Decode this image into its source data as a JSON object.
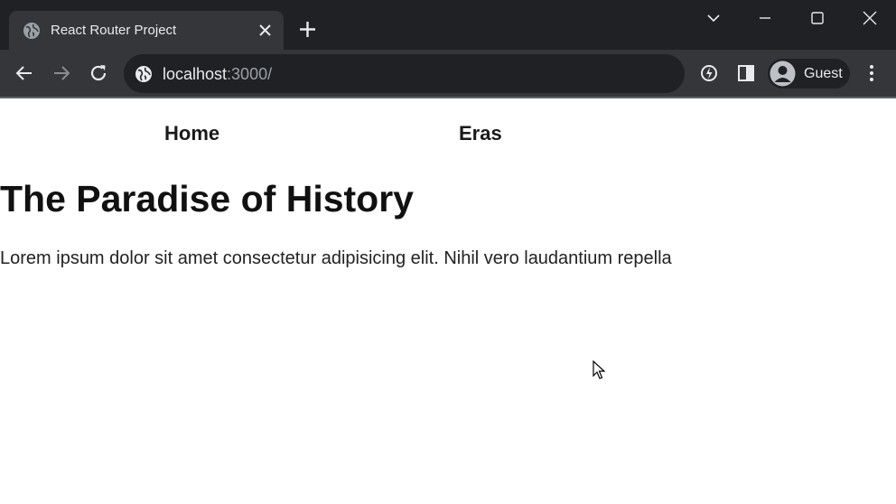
{
  "browser": {
    "tab": {
      "title": "React Router Project"
    },
    "address": {
      "host": "localhost",
      "rest": ":3000/"
    },
    "profile": {
      "label": "Guest"
    }
  },
  "page": {
    "nav": [
      {
        "label": "Home"
      },
      {
        "label": "Eras"
      }
    ],
    "title": "The Paradise of History",
    "text": "Lorem ipsum dolor sit amet consectetur adipisicing elit. Nihil vero laudantium repella"
  },
  "colors": {
    "chrome_dark": "#202124",
    "chrome_toolbar": "#35363a",
    "chrome_text": "#e8eaed",
    "page_background": "#ffffff"
  }
}
